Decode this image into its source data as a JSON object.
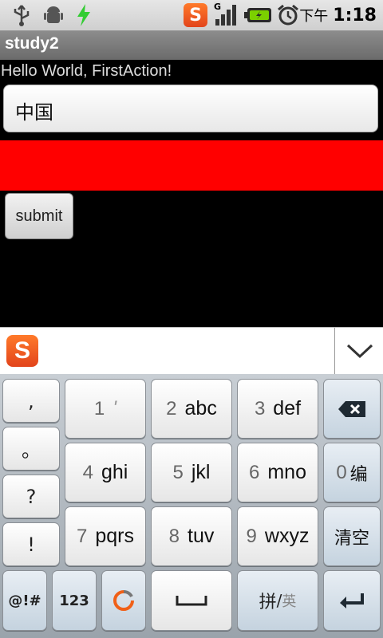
{
  "status_bar": {
    "icons": [
      "usb-icon",
      "android-debug-icon",
      "charging-bolt-icon",
      "sogou-icon",
      "signal-icon",
      "battery-icon",
      "alarm-icon"
    ],
    "network_label": "G",
    "ampm": "下午",
    "time": "1:18"
  },
  "app": {
    "title": "study2",
    "hello_text": "Hello World, FirstAction!",
    "input_value": "中国",
    "submit_label": "submit",
    "accent_red": "#ff0000"
  },
  "ime": {
    "logo_letter": "S",
    "collapse_icon": "chevron-down-icon"
  },
  "keyboard": {
    "punct": [
      ",",
      "。",
      "?",
      "!"
    ],
    "keys": [
      {
        "num": "1",
        "letters": "'"
      },
      {
        "num": "2",
        "letters": "abc"
      },
      {
        "num": "3",
        "letters": "def"
      },
      {
        "num": "4",
        "letters": "ghi"
      },
      {
        "num": "5",
        "letters": "jkl"
      },
      {
        "num": "6",
        "letters": "mno"
      },
      {
        "num": "7",
        "letters": "pqrs"
      },
      {
        "num": "8",
        "letters": "tuv"
      },
      {
        "num": "9",
        "letters": "wxyz"
      }
    ],
    "zero_num": "0",
    "zero_label": "编",
    "clear_label": "清空",
    "symbols_label": "@!#",
    "numbers_label": "123",
    "lang_main": "拼",
    "lang_sep": "/",
    "lang_alt": "英"
  }
}
